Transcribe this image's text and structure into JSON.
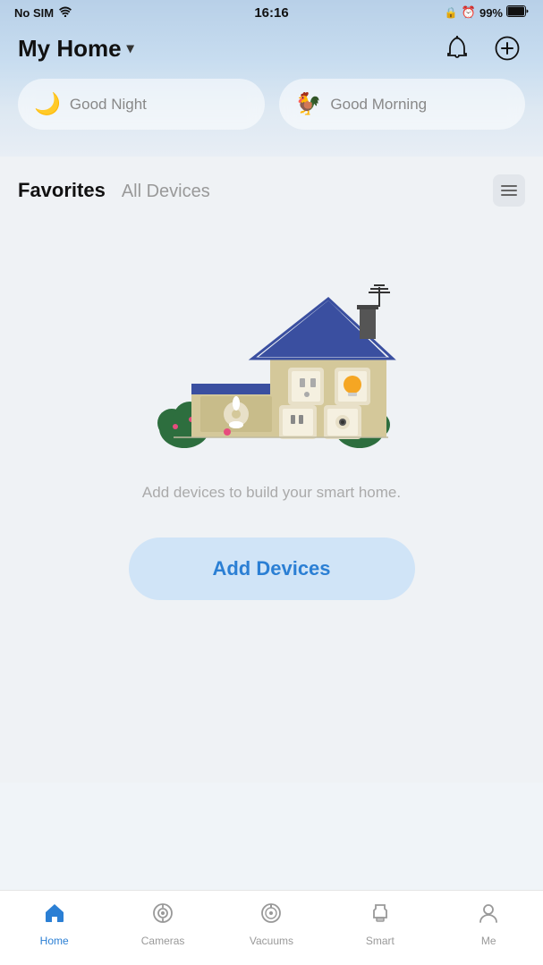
{
  "status_bar": {
    "carrier": "No SIM",
    "time": "16:16",
    "battery": "99%"
  },
  "header": {
    "title": "My Home",
    "notification_icon": "bell-icon",
    "add_icon": "plus-circle-icon"
  },
  "scenes": [
    {
      "id": "good_night",
      "label": "Good Night",
      "icon": "🌙"
    },
    {
      "id": "good_morning",
      "label": "Good Morning",
      "icon": "🐔"
    }
  ],
  "tabs": {
    "active": "Favorites",
    "inactive": "All Devices"
  },
  "empty_state": {
    "text": "Add devices to build your smart home."
  },
  "add_button": {
    "label": "Add Devices"
  },
  "bottom_nav": [
    {
      "id": "home",
      "label": "Home",
      "active": true
    },
    {
      "id": "cameras",
      "label": "Cameras",
      "active": false
    },
    {
      "id": "vacuums",
      "label": "Vacuums",
      "active": false
    },
    {
      "id": "smart",
      "label": "Smart",
      "active": false
    },
    {
      "id": "me",
      "label": "Me",
      "active": false
    }
  ]
}
